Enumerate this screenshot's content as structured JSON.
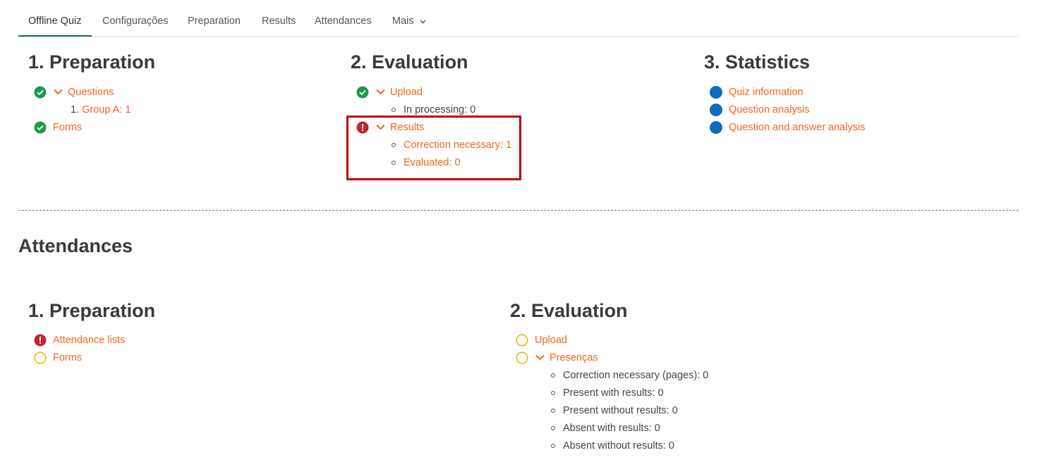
{
  "tabs": [
    {
      "label": "Offline Quiz",
      "active": true
    },
    {
      "label": "Configurações"
    },
    {
      "label": "Preparation"
    },
    {
      "label": "Results"
    },
    {
      "label": "Attendances"
    },
    {
      "label": "Mais"
    }
  ],
  "quiz": {
    "preparation": {
      "title": "1. Preparation",
      "questions": "Questions",
      "group_number": "1.",
      "group_label": "Group A: 1",
      "forms": "Forms"
    },
    "evaluation": {
      "title": "2. Evaluation",
      "upload": "Upload",
      "in_processing": "In processing: 0",
      "results": "Results",
      "correction_necessary": "Correction necessary: 1",
      "evaluated": "Evaluated: 0"
    },
    "statistics": {
      "title": "3. Statistics",
      "items": [
        "Quiz information",
        "Question analysis",
        "Question and answer analysis"
      ]
    }
  },
  "attendances": {
    "title": "Attendances",
    "preparation": {
      "title": "1. Preparation",
      "attendance_lists": "Attendance lists",
      "forms": "Forms"
    },
    "evaluation": {
      "title": "2. Evaluation",
      "upload": "Upload",
      "presencas": "Presenças",
      "details": [
        "Correction necessary (pages): 0",
        "Present with results: 0",
        "Present without results: 0",
        "Absent with results: 0",
        "Absent without results: 0"
      ]
    }
  },
  "colors": {
    "link": "#f26522",
    "success": "#1a9a4a",
    "danger": "#c0262d",
    "info": "#0f6cbd",
    "pending": "#f0b400",
    "active_tab": "#0f6e49",
    "highlight": "#c00000"
  }
}
